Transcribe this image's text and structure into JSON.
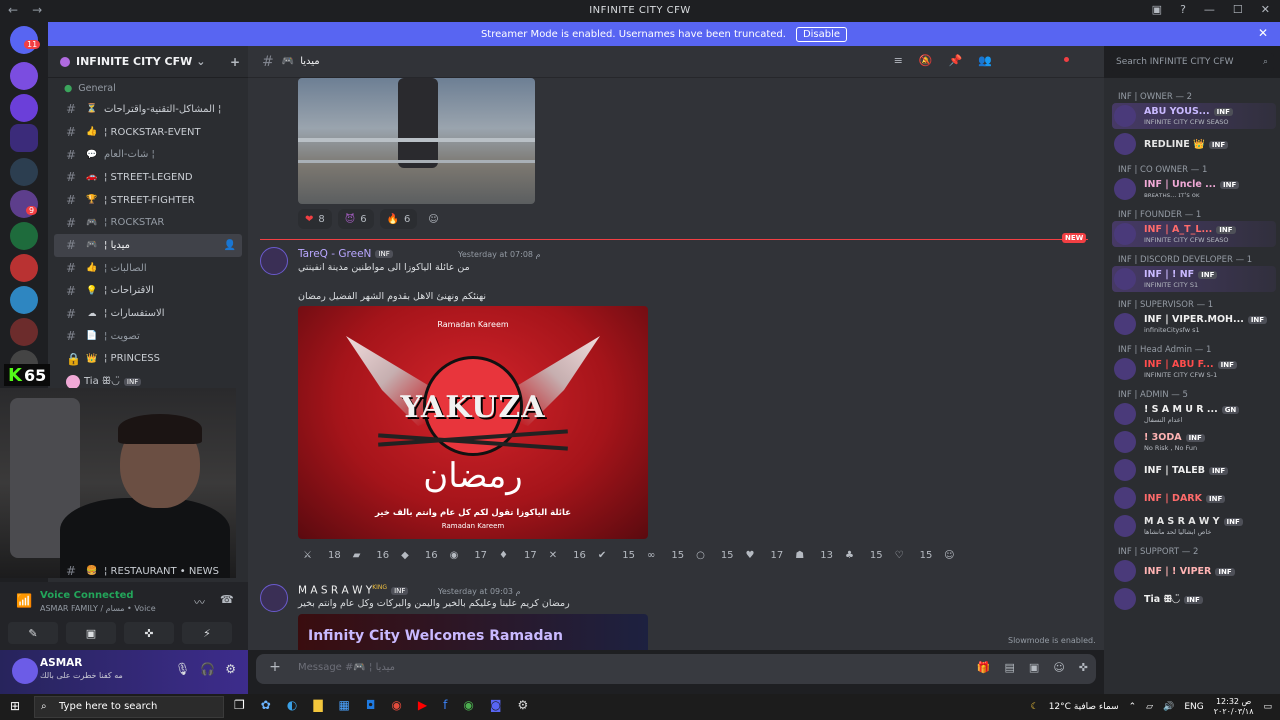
{
  "window": {
    "title": "INFINITE CITY CFW",
    "nav_back": "←",
    "nav_forward": "→",
    "controls": [
      "▣",
      "?",
      "—",
      "☐",
      "✕"
    ]
  },
  "banner": {
    "text": "Streamer Mode is enabled. Usernames have been truncated.",
    "button": "Disable",
    "close": "✕"
  },
  "servers": {
    "mail_badge": "11",
    "badge2": "9",
    "colors": [
      "#5865f2",
      "#7b4de0",
      "#6b3fd9",
      "#3b2b7a",
      "#c0392b",
      "#2c3e50",
      "#5d3e8c",
      "#1e6b3c",
      "#b93232",
      "#e08e25",
      "#2e86c1",
      "#444",
      "#6c2c2c",
      "#333"
    ]
  },
  "guild": {
    "name": "INFINITE CITY CFW",
    "add_icon": "+"
  },
  "channels": {
    "category": "General",
    "items": [
      {
        "emoji": "⏳",
        "label": "المشاكل-التقنية-واقتراحات ¦",
        "state": "bright"
      },
      {
        "emoji": "👍",
        "label": "¦ ROCKSTAR-EVENT",
        "state": "bright"
      },
      {
        "emoji": "💬",
        "label": "شات-العام ¦",
        "state": "dim"
      },
      {
        "emoji": "🚗",
        "label": "¦ STREET-LEGEND",
        "state": "bright"
      },
      {
        "emoji": "🏆",
        "label": "¦ STREET-FIGHTER",
        "state": "bright"
      },
      {
        "emoji": "🎮",
        "label": "¦ ROCKSTAR",
        "state": "dim"
      },
      {
        "emoji": "🎮",
        "label": "¦ ميديا",
        "state": "active"
      },
      {
        "emoji": "👍",
        "label": "¦ الصالبات",
        "state": "dim"
      },
      {
        "emoji": "💡",
        "label": "¦ الاقتراحات",
        "state": "bright"
      },
      {
        "emoji": "☁",
        "label": "¦ الاستفسارات",
        "state": "bright"
      },
      {
        "emoji": "📄",
        "label": "¦ تصويت",
        "state": "dim"
      },
      {
        "emoji": "👑",
        "label": "¦ PRINCESS",
        "state": "bright"
      }
    ],
    "voice_user": {
      "name": "Tia ꕥ◡̈",
      "tag": "INF"
    },
    "restaurant": "¦ RESTAURANT • NEWS"
  },
  "webcam": {
    "kick_count": "65"
  },
  "voice": {
    "status": "Voice Connected",
    "sub": "ASMAR FAMILY / مسام • Voice",
    "buttons": [
      "✎",
      "▣",
      "✜",
      "⚡"
    ]
  },
  "user": {
    "name": "ASMAR",
    "status": "مه كفنا خطرت على بالك"
  },
  "chat_header": {
    "channel": "ميديا",
    "search_placeholder": "Search INFINITE CITY CFW"
  },
  "messages": {
    "first_reactions": [
      {
        "emoji": "❤",
        "count": "8",
        "color": "#f23f43"
      },
      {
        "emoji": "😈",
        "count": "6",
        "color": "#9b59b6"
      },
      {
        "emoji": "🔥",
        "count": "6",
        "color": "#f39c12"
      }
    ],
    "new_label": "NEW",
    "msg1": {
      "author": "TareQ - GreeN",
      "tag": "INF",
      "timestamp": "Yesterday at 07:08 م",
      "line1": "من عائلة الياكوزا الى مواطنين مدينة انفينتي",
      "line2": "نهنئكم ونهنئ الاهل بقدوم الشهر الفضيل رمضان"
    },
    "poster": {
      "top": "Ramadan Kareem",
      "brand": "YAKUZA",
      "calligraphy": "رمضان",
      "greeting": "عائلة الياكوزا تقول لكم كل عام وانتم بالف خير",
      "bottom": "Ramadan Kareem"
    },
    "second_reactions": [
      {
        "emoji": "⚔",
        "count": "18"
      },
      {
        "emoji": "▰",
        "count": "16"
      },
      {
        "emoji": "◆",
        "count": "16"
      },
      {
        "emoji": "◉",
        "count": "17"
      },
      {
        "emoji": "♦",
        "count": "17"
      },
      {
        "emoji": "✕",
        "count": "16"
      },
      {
        "emoji": "✔",
        "count": "15"
      },
      {
        "emoji": "∞",
        "count": "15"
      },
      {
        "emoji": "○",
        "count": "15"
      },
      {
        "emoji": "♥",
        "count": "17"
      },
      {
        "emoji": "☗",
        "count": "13"
      },
      {
        "emoji": "♣",
        "count": "15"
      },
      {
        "emoji": "♡",
        "count": "15"
      }
    ],
    "msg2": {
      "author": "M A S R A W Y",
      "king": "KING",
      "tag": "INF",
      "timestamp": "Yesterday at 09:03 م",
      "text": "رمضان كريم علينا وعليكم بالخير واليمن والبركات وكل عام وانتم بخير"
    },
    "image3_text": "Infinity City Welcomes Ramadan",
    "slowmode": "Slowmode is enabled."
  },
  "composer": {
    "placeholder": "Message #🎮 ¦ ميديا"
  },
  "members": [
    {
      "role": "INF | OWNER — 2",
      "users": [
        {
          "name": "ABU YOUS...",
          "status": "INFINITE CITY CFW SEASO",
          "color": "#c9b9ff",
          "tag": "INF"
        },
        {
          "name": "REDLINE 👑",
          "status": "",
          "color": "#e6e6e6",
          "tag": "INF"
        }
      ]
    },
    {
      "role": "INF | CO OWNER — 1",
      "users": [
        {
          "name": "INF | Uncle ...",
          "status": "ʙʀᴇᴀᴛʜs... ɪᴛ's ᴏᴋ",
          "color": "#f0a9d6",
          "tag": "INF"
        }
      ]
    },
    {
      "role": "INF | FOUNDER — 1",
      "users": [
        {
          "name": "INF | A_T_L...",
          "status": "INFINITE CITY CFW SEASO",
          "color": "#ff6b6b",
          "tag": "INF"
        }
      ]
    },
    {
      "role": "INF | DISCORD DEVELOPER — 1",
      "users": [
        {
          "name": "INF | ! NF",
          "status": "INFINITE CITY S1",
          "color": "#c9b9ff",
          "tag": "INF"
        }
      ]
    },
    {
      "role": "INF | SUPERVISOR — 1",
      "users": [
        {
          "name": "INF | VIPER.MOH...",
          "status": "infiniteCitysfw s1",
          "color": "#f0f0f0",
          "tag": "INF"
        }
      ]
    },
    {
      "role": "INF | Head Admin — 1",
      "users": [
        {
          "name": "INF | ABU F...",
          "status": "INFINITE CITY CFW S-1",
          "color": "#ff4d4d",
          "tag": "INF"
        }
      ]
    },
    {
      "role": "INF | ADMIN — 5",
      "users": [
        {
          "name": "! S A M U R ...",
          "status": "اعدام النسفال",
          "color": "#f0f0f0",
          "tag": "GN"
        },
        {
          "name": "! 3ODA",
          "status": "No Risk , No Fun",
          "color": "#ffb3b3",
          "tag": "INF"
        },
        {
          "name": "INF | TALEB",
          "status": "",
          "color": "#f0f0f0",
          "tag": "INF"
        },
        {
          "name": "INF | DARK",
          "status": "",
          "color": "#ff6b6b",
          "tag": "INF"
        },
        {
          "name": "M A S R A W Y",
          "status": "خاص ابشاليا لحد مانشاها",
          "color": "#e6e6e6",
          "tag": "INF"
        }
      ]
    },
    {
      "role": "INF | SUPPORT — 2",
      "users": [
        {
          "name": "INF | ! VIPER",
          "status": "",
          "color": "#ffb3b3",
          "tag": "INF"
        },
        {
          "name": "Tia ꕥ◡̈",
          "status": "",
          "color": "#f0f0f0",
          "tag": "INF"
        }
      ]
    }
  ],
  "taskbar": {
    "search": "Type here to search",
    "weather": "12°C  سماء صافية",
    "lang": "ENG",
    "time": "12:32 ص",
    "date": "٢٠٢٠/٠٣/١٨"
  }
}
